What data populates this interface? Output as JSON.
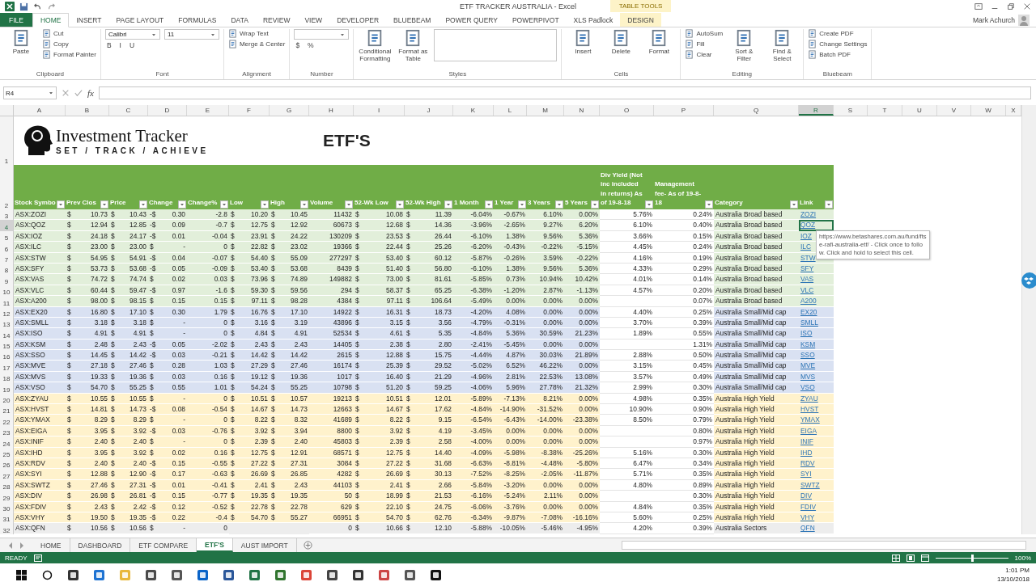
{
  "title_bar": {
    "title": "ETF TRACKER AUSTRALIA - Excel",
    "user": "Mark Achurch"
  },
  "ribbon_tabs": [
    {
      "label": "FILE",
      "kind": "file",
      "selected": false
    },
    {
      "label": "HOME",
      "kind": "normal",
      "selected": true
    },
    {
      "label": "INSERT",
      "kind": "normal",
      "selected": false
    },
    {
      "label": "PAGE LAYOUT",
      "kind": "normal",
      "selected": false
    },
    {
      "label": "FORMULAS",
      "kind": "normal",
      "selected": false
    },
    {
      "label": "DATA",
      "kind": "normal",
      "selected": false
    },
    {
      "label": "REVIEW",
      "kind": "normal",
      "selected": false
    },
    {
      "label": "VIEW",
      "kind": "normal",
      "selected": false
    },
    {
      "label": "DEVELOPER",
      "kind": "normal",
      "selected": false
    },
    {
      "label": "BLUEBEAM",
      "kind": "normal",
      "selected": false
    },
    {
      "label": "POWER QUERY",
      "kind": "normal",
      "selected": false
    },
    {
      "label": "POWERPIVOT",
      "kind": "normal",
      "selected": false
    },
    {
      "label": "XLS Padlock",
      "kind": "normal",
      "selected": false
    },
    {
      "label": "DESIGN",
      "kind": "contextual",
      "context": "TABLE TOOLS",
      "selected": false
    }
  ],
  "ribbon_groups": [
    {
      "label": "Clipboard",
      "columns": [
        [
          {
            "kind": "large",
            "label": "Paste"
          }
        ],
        [
          {
            "kind": "small",
            "label": "Cut"
          },
          {
            "kind": "small",
            "label": "Copy"
          },
          {
            "kind": "small",
            "label": "Format Painter"
          }
        ]
      ]
    },
    {
      "label": "Font",
      "columns": [
        [
          {
            "kind": "field",
            "value": "Calibri"
          },
          {
            "kind": "glyphs",
            "glyphs": [
              "B",
              "I",
              "U"
            ]
          }
        ],
        [
          {
            "kind": "field",
            "value": "11"
          }
        ]
      ]
    },
    {
      "label": "Alignment",
      "columns": [
        [
          {
            "kind": "small",
            "label": "Wrap Text"
          },
          {
            "kind": "small",
            "label": "Merge & Center"
          }
        ]
      ]
    },
    {
      "label": "Number",
      "columns": [
        [
          {
            "kind": "field"
          },
          {
            "kind": "glyphs",
            "glyphs": [
              "$",
              "%"
            ]
          }
        ]
      ]
    },
    {
      "label": "Styles",
      "columns": [
        [
          {
            "kind": "large",
            "label": "Conditional Formatting"
          }
        ],
        [
          {
            "kind": "large",
            "label": "Format as Table"
          }
        ],
        [
          {
            "kind": "gallery"
          }
        ]
      ]
    },
    {
      "label": "Cells",
      "columns": [
        [
          {
            "kind": "large",
            "label": "Insert"
          }
        ],
        [
          {
            "kind": "large",
            "label": "Delete"
          }
        ],
        [
          {
            "kind": "large",
            "label": "Format"
          }
        ]
      ]
    },
    {
      "label": "Editing",
      "columns": [
        [
          {
            "kind": "small",
            "label": "AutoSum"
          },
          {
            "kind": "small",
            "label": "Fill"
          },
          {
            "kind": "small",
            "label": "Clear"
          }
        ],
        [
          {
            "kind": "large",
            "label": "Sort & Filter"
          }
        ],
        [
          {
            "kind": "large",
            "label": "Find & Select"
          }
        ]
      ]
    },
    {
      "label": "Bluebeam",
      "columns": [
        [
          {
            "kind": "small",
            "label": "Create PDF"
          },
          {
            "kind": "small",
            "label": "Change Settings"
          },
          {
            "kind": "small",
            "label": "Batch PDF"
          }
        ]
      ]
    }
  ],
  "formula_bar": {
    "name_box": "R4",
    "fx": "fx"
  },
  "column_letters": [
    {
      "letter": "A",
      "selected": false
    },
    {
      "letter": "B",
      "selected": false
    },
    {
      "letter": "C",
      "selected": false
    },
    {
      "letter": "D",
      "selected": false
    },
    {
      "letter": "E",
      "selected": false
    },
    {
      "letter": "F",
      "selected": false
    },
    {
      "letter": "G",
      "selected": false
    },
    {
      "letter": "H",
      "selected": false
    },
    {
      "letter": "I",
      "selected": false
    },
    {
      "letter": "J",
      "selected": false
    },
    {
      "letter": "K",
      "selected": false
    },
    {
      "letter": "L",
      "selected": false
    },
    {
      "letter": "M",
      "selected": false
    },
    {
      "letter": "N",
      "selected": false
    },
    {
      "letter": "O",
      "selected": false
    },
    {
      "letter": "P",
      "selected": false
    },
    {
      "letter": "Q",
      "selected": false
    },
    {
      "letter": "R",
      "selected": true
    },
    {
      "letter": "S",
      "selected": false
    },
    {
      "letter": "T",
      "selected": false
    },
    {
      "letter": "U",
      "selected": false
    },
    {
      "letter": "V",
      "selected": false
    },
    {
      "letter": "W",
      "selected": false
    },
    {
      "letter": "X",
      "selected": false
    }
  ],
  "banner": {
    "row": "1",
    "brand": "Investment Tracker",
    "tagline": "SET / TRACK / ACHIEVE",
    "sheet_title": "ETF'S"
  },
  "header_row": {
    "row": "2",
    "headers": [
      "Stock Symbo",
      "Prev Clos",
      "Price",
      "Change",
      "Change%",
      "Low",
      "High",
      "Volume",
      "52-Wk Low",
      "52-Wk High",
      "1 Month",
      "1 Year",
      "3 Years",
      "5 Years",
      "Div Yield (Not inc included in returns) As of 19-8-18",
      "Management fee- As of 19-8-18",
      "Category",
      "Link"
    ]
  },
  "rows": [
    {
      "n": "3",
      "color": "#e2efda",
      "selected": false,
      "cells": [
        "ASX:ZOZI",
        [
          "$",
          "10.73"
        ],
        [
          "$",
          "10.43"
        ],
        [
          "-$",
          "0.30"
        ],
        "-2.8",
        [
          "$",
          "10.20"
        ],
        [
          "$",
          "10.45"
        ],
        "11432",
        [
          "$",
          "10.08"
        ],
        [
          "$",
          "11.39"
        ],
        "-6.04%",
        "-0.67%",
        "6.10%",
        "0.00%",
        "5.76%",
        "0.24%",
        "Australia Broad based",
        "ZOZI"
      ]
    },
    {
      "n": "4",
      "color": "#e2efda",
      "selected": true,
      "cells": [
        "ASX:QOZ",
        [
          "$",
          "12.94"
        ],
        [
          "$",
          "12.85"
        ],
        [
          "-$",
          "0.09"
        ],
        "-0.7",
        [
          "$",
          "12.75"
        ],
        [
          "$",
          "12.92"
        ],
        "60673",
        [
          "$",
          "12.68"
        ],
        [
          "$",
          "14.36"
        ],
        "-3.96%",
        "-2.65%",
        "9.27%",
        "6.20%",
        "6.10%",
        "0.40%",
        "Australia Broad based",
        "QOZ"
      ]
    },
    {
      "n": "5",
      "color": "#e2efda",
      "selected": false,
      "cells": [
        "ASX:IOZ",
        [
          "$",
          "24.18"
        ],
        [
          "$",
          "24.17"
        ],
        [
          "-$",
          "0.01"
        ],
        "-0.04",
        [
          "$",
          "23.91"
        ],
        [
          "$",
          "24.22"
        ],
        "130209",
        [
          "$",
          "23.53"
        ],
        [
          "$",
          "26.44"
        ],
        "-6.10%",
        "1.38%",
        "9.56%",
        "5.36%",
        "3.66%",
        "0.15%",
        "Australia Broad based",
        "IOZ"
      ]
    },
    {
      "n": "6",
      "color": "#e2efda",
      "selected": false,
      "cells": [
        "ASX:ILC",
        [
          "$",
          "23.00"
        ],
        [
          "$",
          "23.00"
        ],
        [
          "$",
          "-"
        ],
        "0",
        [
          "$",
          "22.82"
        ],
        [
          "$",
          "23.02"
        ],
        "19366",
        [
          "$",
          "22.44"
        ],
        [
          "$",
          "25.26"
        ],
        "-6.20%",
        "-0.43%",
        "-0.22%",
        "-5.15%",
        "4.45%",
        "0.24%",
        "Australia Broad based",
        "ILC"
      ]
    },
    {
      "n": "7",
      "color": "#e2efda",
      "selected": false,
      "cells": [
        "ASX:STW",
        [
          "$",
          "54.95"
        ],
        [
          "$",
          "54.91"
        ],
        [
          "-$",
          "0.04"
        ],
        "-0.07",
        [
          "$",
          "54.40"
        ],
        [
          "$",
          "55.09"
        ],
        "277297",
        [
          "$",
          "53.40"
        ],
        [
          "$",
          "60.12"
        ],
        "-5.87%",
        "-0.26%",
        "3.59%",
        "-0.22%",
        "4.16%",
        "0.19%",
        "Australia Broad based",
        "STW"
      ]
    },
    {
      "n": "8",
      "color": "#e2efda",
      "selected": false,
      "cells": [
        "ASX:SFY",
        [
          "$",
          "53.73"
        ],
        [
          "$",
          "53.68"
        ],
        [
          "-$",
          "0.05"
        ],
        "-0.09",
        [
          "$",
          "53.40"
        ],
        [
          "$",
          "53.68"
        ],
        "8439",
        [
          "$",
          "51.40"
        ],
        [
          "$",
          "56.80"
        ],
        "-6.10%",
        "1.38%",
        "9.56%",
        "5.36%",
        "4.33%",
        "0.29%",
        "Australia Broad based",
        "SFY"
      ]
    },
    {
      "n": "9",
      "color": "#e2efda",
      "selected": false,
      "cells": [
        "ASX:VAS",
        [
          "$",
          "74.72"
        ],
        [
          "$",
          "74.74"
        ],
        [
          "$",
          "0.02"
        ],
        "0.03",
        [
          "$",
          "73.96"
        ],
        [
          "$",
          "74.89"
        ],
        "149882",
        [
          "$",
          "73.00"
        ],
        [
          "$",
          "81.61"
        ],
        "-5.85%",
        "0.73%",
        "10.94%",
        "10.42%",
        "4.01%",
        "0.14%",
        "Australia Broad based",
        "VAS"
      ]
    },
    {
      "n": "10",
      "color": "#e2efda",
      "selected": false,
      "cells": [
        "ASX:VLC",
        [
          "$",
          "60.44"
        ],
        [
          "$",
          "59.47"
        ],
        [
          "-$",
          "0.97"
        ],
        "-1.6",
        [
          "$",
          "59.30"
        ],
        [
          "$",
          "59.56"
        ],
        "294",
        [
          "$",
          "58.37"
        ],
        [
          "$",
          "65.25"
        ],
        "-6.38%",
        "-1.20%",
        "2.87%",
        "-1.13%",
        "4.57%",
        "0.20%",
        "Australia Broad based",
        "VLC"
      ]
    },
    {
      "n": "11",
      "color": "#e2efda",
      "selected": false,
      "cells": [
        "ASX:A200",
        [
          "$",
          "98.00"
        ],
        [
          "$",
          "98.15"
        ],
        [
          "$",
          "0.15"
        ],
        "0.15",
        [
          "$",
          "97.11"
        ],
        [
          "$",
          "98.28"
        ],
        "4384",
        [
          "$",
          "97.11"
        ],
        [
          "$",
          "106.64"
        ],
        "-5.49%",
        "0.00%",
        "0.00%",
        "0.00%",
        null,
        "0.07%",
        "Australia Broad based",
        "A200"
      ]
    },
    {
      "n": "12",
      "color": "#d9e1f2",
      "selected": false,
      "cells": [
        "ASX:EX20",
        [
          "$",
          "16.80"
        ],
        [
          "$",
          "17.10"
        ],
        [
          "$",
          "0.30"
        ],
        "1.79",
        [
          "$",
          "16.76"
        ],
        [
          "$",
          "17.10"
        ],
        "14922",
        [
          "$",
          "16.31"
        ],
        [
          "$",
          "18.73"
        ],
        "-4.20%",
        "4.08%",
        "0.00%",
        "0.00%",
        "4.40%",
        "0.25%",
        "Australia Small/Mid cap",
        "EX20"
      ]
    },
    {
      "n": "13",
      "color": "#d9e1f2",
      "selected": false,
      "cells": [
        "ASX:SMLL",
        [
          "$",
          "3.18"
        ],
        [
          "$",
          "3.18"
        ],
        [
          "$",
          "-"
        ],
        "0",
        [
          "$",
          "3.16"
        ],
        [
          "$",
          "3.19"
        ],
        "43896",
        [
          "$",
          "3.15"
        ],
        [
          "$",
          "3.56"
        ],
        "-4.79%",
        "-0.31%",
        "0.00%",
        "0.00%",
        "3.70%",
        "0.39%",
        "Australia Small/Mid cap",
        "SMLL"
      ]
    },
    {
      "n": "14",
      "color": "#d9e1f2",
      "selected": false,
      "cells": [
        "ASX:ISO",
        [
          "$",
          "4.91"
        ],
        [
          "$",
          "4.91"
        ],
        [
          "$",
          "-"
        ],
        "0",
        [
          "$",
          "4.84"
        ],
        [
          "$",
          "4.91"
        ],
        "52534",
        [
          "$",
          "4.61"
        ],
        [
          "$",
          "5.35"
        ],
        "-4.84%",
        "5.36%",
        "30.59%",
        "21.23%",
        "1.89%",
        "0.55%",
        "Australia Small/Mid cap",
        "ISO"
      ]
    },
    {
      "n": "15",
      "color": "#d9e1f2",
      "selected": false,
      "cells": [
        "ASX:KSM",
        [
          "$",
          "2.48"
        ],
        [
          "$",
          "2.43"
        ],
        [
          "-$",
          "0.05"
        ],
        "-2.02",
        [
          "$",
          "2.43"
        ],
        [
          "$",
          "2.43"
        ],
        "14405",
        [
          "$",
          "2.38"
        ],
        [
          "$",
          "2.80"
        ],
        "-2.41%",
        "-5.45%",
        "0.00%",
        "0.00%",
        null,
        "1.31%",
        "Australia Small/Mid cap",
        "KSM"
      ]
    },
    {
      "n": "16",
      "color": "#d9e1f2",
      "selected": false,
      "cells": [
        "ASX:SSO",
        [
          "$",
          "14.45"
        ],
        [
          "$",
          "14.42"
        ],
        [
          "-$",
          "0.03"
        ],
        "-0.21",
        [
          "$",
          "14.42"
        ],
        [
          "$",
          "14.42"
        ],
        "2615",
        [
          "$",
          "12.88"
        ],
        [
          "$",
          "15.75"
        ],
        "-4.44%",
        "4.87%",
        "30.03%",
        "21.89%",
        "2.88%",
        "0.50%",
        "Australia Small/Mid cap",
        "SSO"
      ]
    },
    {
      "n": "17",
      "color": "#d9e1f2",
      "selected": false,
      "cells": [
        "ASX:MVE",
        [
          "$",
          "27.18"
        ],
        [
          "$",
          "27.46"
        ],
        [
          "$",
          "0.28"
        ],
        "1.03",
        [
          "$",
          "27.29"
        ],
        [
          "$",
          "27.46"
        ],
        "16174",
        [
          "$",
          "25.39"
        ],
        [
          "$",
          "29.52"
        ],
        "-5.02%",
        "6.52%",
        "46.22%",
        "0.00%",
        "3.15%",
        "0.45%",
        "Australia Small/Mid cap",
        "MVE"
      ]
    },
    {
      "n": "18",
      "color": "#d9e1f2",
      "selected": false,
      "cells": [
        "ASX:MVS",
        [
          "$",
          "19.33"
        ],
        [
          "$",
          "19.36"
        ],
        [
          "$",
          "0.03"
        ],
        "0.16",
        [
          "$",
          "19.12"
        ],
        [
          "$",
          "19.36"
        ],
        "1017",
        [
          "$",
          "16.40"
        ],
        [
          "$",
          "21.29"
        ],
        "-4.96%",
        "2.81%",
        "22.53%",
        "13.08%",
        "3.57%",
        "0.49%",
        "Australia Small/Mid cap",
        "MVS"
      ]
    },
    {
      "n": "19",
      "color": "#d9e1f2",
      "selected": false,
      "cells": [
        "ASX:VSO",
        [
          "$",
          "54.70"
        ],
        [
          "$",
          "55.25"
        ],
        [
          "$",
          "0.55"
        ],
        "1.01",
        [
          "$",
          "54.24"
        ],
        [
          "$",
          "55.25"
        ],
        "10798",
        [
          "$",
          "51.20"
        ],
        [
          "$",
          "59.25"
        ],
        "-4.06%",
        "5.96%",
        "27.78%",
        "21.32%",
        "2.99%",
        "0.30%",
        "Australia Small/Mid cap",
        "VSO"
      ]
    },
    {
      "n": "20",
      "color": "#fff2cc",
      "selected": false,
      "cells": [
        "ASX:ZYAU",
        [
          "$",
          "10.55"
        ],
        [
          "$",
          "10.55"
        ],
        [
          "$",
          "-"
        ],
        "0",
        [
          "$",
          "10.51"
        ],
        [
          "$",
          "10.57"
        ],
        "19213",
        [
          "$",
          "10.51"
        ],
        [
          "$",
          "12.01"
        ],
        "-5.89%",
        "-7.13%",
        "8.21%",
        "0.00%",
        "4.98%",
        "0.35%",
        "Australia High Yield",
        "ZYAU"
      ]
    },
    {
      "n": "21",
      "color": "#fff2cc",
      "selected": false,
      "cells": [
        "ASX:HVST",
        [
          "$",
          "14.81"
        ],
        [
          "$",
          "14.73"
        ],
        [
          "-$",
          "0.08"
        ],
        "-0.54",
        [
          "$",
          "14.67"
        ],
        [
          "$",
          "14.73"
        ],
        "12663",
        [
          "$",
          "14.67"
        ],
        [
          "$",
          "17.62"
        ],
        "-4.84%",
        "-14.90%",
        "-31.52%",
        "0.00%",
        "10.90%",
        "0.90%",
        "Australia High Yield",
        "HVST"
      ]
    },
    {
      "n": "22",
      "color": "#fff2cc",
      "selected": false,
      "cells": [
        "ASX:YMAX",
        [
          "$",
          "8.29"
        ],
        [
          "$",
          "8.29"
        ],
        [
          "$",
          "-"
        ],
        "0",
        [
          "$",
          "8.22"
        ],
        [
          "$",
          "8.32"
        ],
        "41689",
        [
          "$",
          "8.22"
        ],
        [
          "$",
          "9.15"
        ],
        "-6.54%",
        "-6.43%",
        "-14.00%",
        "-23.38%",
        "8.50%",
        "0.79%",
        "Australia High Yield",
        "YMAX"
      ]
    },
    {
      "n": "23",
      "color": "#fff2cc",
      "selected": false,
      "cells": [
        "ASX:EIGA",
        [
          "$",
          "3.95"
        ],
        [
          "$",
          "3.92"
        ],
        [
          "-$",
          "0.03"
        ],
        "-0.76",
        [
          "$",
          "3.92"
        ],
        [
          "$",
          "3.94"
        ],
        "8800",
        [
          "$",
          "3.92"
        ],
        [
          "$",
          "4.19"
        ],
        "-3.45%",
        "0.00%",
        "0.00%",
        "0.00%",
        null,
        "0.80%",
        "Australia High Yield",
        "EIGA"
      ]
    },
    {
      "n": "24",
      "color": "#fff2cc",
      "selected": false,
      "cells": [
        "ASX:INIF",
        [
          "$",
          "2.40"
        ],
        [
          "$",
          "2.40"
        ],
        [
          "$",
          "-"
        ],
        "0",
        [
          "$",
          "2.39"
        ],
        [
          "$",
          "2.40"
        ],
        "45803",
        [
          "$",
          "2.39"
        ],
        [
          "$",
          "2.58"
        ],
        "-4.00%",
        "0.00%",
        "0.00%",
        "0.00%",
        null,
        "0.97%",
        "Australia High Yield",
        "INIF"
      ]
    },
    {
      "n": "25",
      "color": "#fff2cc",
      "selected": false,
      "cells": [
        "ASX:IHD",
        [
          "$",
          "3.95"
        ],
        [
          "$",
          "3.92"
        ],
        [
          "$",
          "0.02"
        ],
        "0.16",
        [
          "$",
          "12.75"
        ],
        [
          "$",
          "12.91"
        ],
        "68571",
        [
          "$",
          "12.75"
        ],
        [
          "$",
          "14.40"
        ],
        "-4.09%",
        "-5.98%",
        "-8.38%",
        "-25.26%",
        "5.16%",
        "0.30%",
        "Australia High Yield",
        "IHD"
      ]
    },
    {
      "n": "26",
      "color": "#fff2cc",
      "selected": false,
      "cells": [
        "ASX:RDV",
        [
          "$",
          "2.40"
        ],
        [
          "$",
          "2.40"
        ],
        [
          "-$",
          "0.15"
        ],
        "-0.55",
        [
          "$",
          "27.22"
        ],
        [
          "$",
          "27.31"
        ],
        "3084",
        [
          "$",
          "27.22"
        ],
        [
          "$",
          "31.68"
        ],
        "-6.63%",
        "-8.81%",
        "-4.48%",
        "-5.80%",
        "6.47%",
        "0.34%",
        "Australia High Yield",
        "RDV"
      ]
    },
    {
      "n": "27",
      "color": "#fff2cc",
      "selected": false,
      "cells": [
        "ASX:SYI",
        [
          "$",
          "12.88"
        ],
        [
          "$",
          "12.90"
        ],
        [
          "-$",
          "0.17"
        ],
        "-0.63",
        [
          "$",
          "26.69"
        ],
        [
          "$",
          "26.85"
        ],
        "4282",
        [
          "$",
          "26.69"
        ],
        [
          "$",
          "30.13"
        ],
        "-7.52%",
        "-8.25%",
        "-2.05%",
        "-11.87%",
        "5.71%",
        "0.35%",
        "Australia High Yield",
        "SYI"
      ]
    },
    {
      "n": "28",
      "color": "#fff2cc",
      "selected": false,
      "cells": [
        "ASX:SWTZ",
        [
          "$",
          "27.46"
        ],
        [
          "$",
          "27.31"
        ],
        [
          "-$",
          "0.01"
        ],
        "-0.41",
        [
          "$",
          "2.41"
        ],
        [
          "$",
          "2.43"
        ],
        "44103",
        [
          "$",
          "2.41"
        ],
        [
          "$",
          "2.66"
        ],
        "-5.84%",
        "-3.20%",
        "0.00%",
        "0.00%",
        "4.80%",
        "0.89%",
        "Australia High Yield",
        "SWTZ"
      ]
    },
    {
      "n": "29",
      "color": "#fff2cc",
      "selected": false,
      "cells": [
        "ASX:DIV",
        [
          "$",
          "26.98"
        ],
        [
          "$",
          "26.81"
        ],
        [
          "-$",
          "0.15"
        ],
        "-0.77",
        [
          "$",
          "19.35"
        ],
        [
          "$",
          "19.35"
        ],
        "50",
        [
          "$",
          "18.99"
        ],
        [
          "$",
          "21.53"
        ],
        "-6.16%",
        "-5.24%",
        "2.11%",
        "0.00%",
        null,
        "0.30%",
        "Australia High Yield",
        "DIV"
      ]
    },
    {
      "n": "30",
      "color": "#fff2cc",
      "selected": false,
      "cells": [
        "ASX:FDIV",
        [
          "$",
          "2.43"
        ],
        [
          "$",
          "2.42"
        ],
        [
          "-$",
          "0.12"
        ],
        "-0.52",
        [
          "$",
          "22.78"
        ],
        [
          "$",
          "22.78"
        ],
        "629",
        [
          "$",
          "22.10"
        ],
        [
          "$",
          "24.75"
        ],
        "-6.06%",
        "-3.76%",
        "0.00%",
        "0.00%",
        "4.84%",
        "0.35%",
        "Australia High Yield",
        "FDIV"
      ]
    },
    {
      "n": "31",
      "color": "#fff2cc",
      "selected": false,
      "cells": [
        "ASX:VHY",
        [
          "$",
          "19.50"
        ],
        [
          "$",
          "19.35"
        ],
        [
          "-$",
          "0.22"
        ],
        "-0.4",
        [
          "$",
          "54.70"
        ],
        [
          "$",
          "55.27"
        ],
        "66951",
        [
          "$",
          "54.70"
        ],
        [
          "$",
          "62.76"
        ],
        "-6.34%",
        "-9.87%",
        "-7.08%",
        "-16.16%",
        "5.60%",
        "0.25%",
        "Australia High Yield",
        "VHY"
      ]
    },
    {
      "n": "32",
      "color": "#ededed",
      "selected": false,
      "cells": [
        "ASX:QFN",
        [
          "$",
          "10.56"
        ],
        [
          "$",
          "10.56"
        ],
        [
          "$",
          "-"
        ],
        "0",
        null,
        null,
        "0",
        [
          "$",
          "10.66"
        ],
        [
          "$",
          "12.10"
        ],
        "-5.88%",
        "-10.05%",
        "-5.46%",
        "-4.95%",
        "4.20%",
        "0.39%",
        "Australia Sectors",
        "QFN"
      ]
    }
  ],
  "tooltip": "https://www.betashares.com.au/fund/ftse-rafi-australia-etf/ - Click once to follow. Click and hold to select this cell.",
  "sheet_tabs": [
    {
      "label": "HOME",
      "selected": false
    },
    {
      "label": "DASHBOARD",
      "selected": false
    },
    {
      "label": "ETF COMPARE",
      "selected": false
    },
    {
      "label": "ETF'S",
      "selected": true
    },
    {
      "label": "AUST IMPORT",
      "selected": false
    }
  ],
  "status_bar": {
    "status": "READY",
    "zoom": {
      "label": "100%",
      "level": 0.5
    }
  },
  "taskbar": {
    "time": "1:01 PM",
    "date": "13/10/2018"
  }
}
